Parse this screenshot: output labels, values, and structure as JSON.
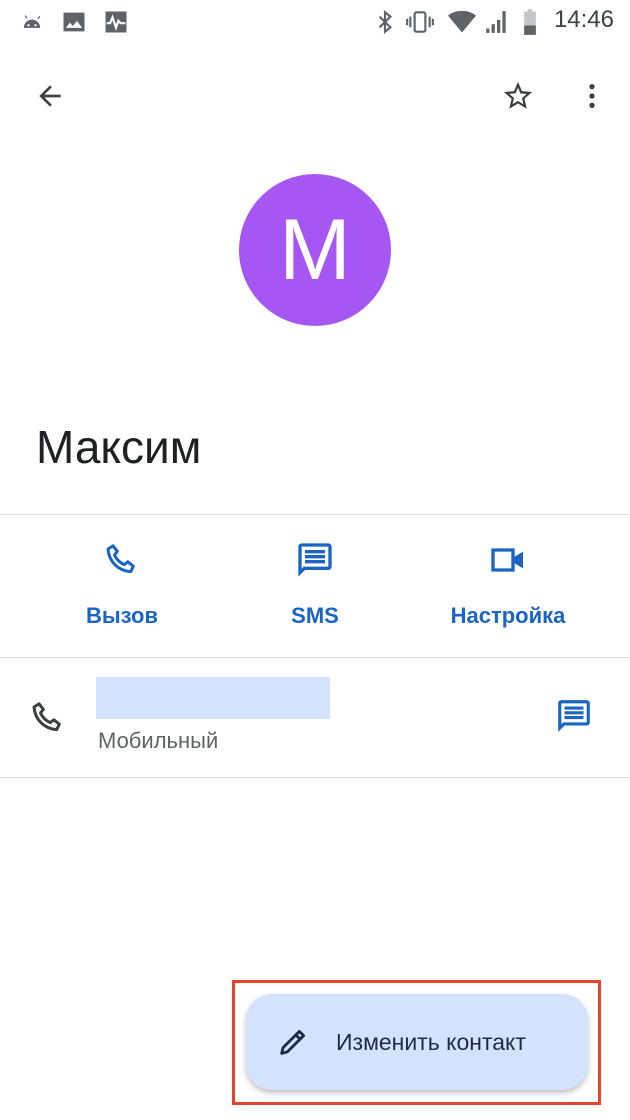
{
  "status_bar": {
    "time": "14:46",
    "left_icons": [
      "android-icon",
      "image-icon",
      "activity-icon"
    ],
    "right_icons": [
      "bluetooth-icon",
      "vibrate-icon",
      "wifi-icon",
      "cell-signal-icon",
      "battery-icon"
    ]
  },
  "toolbar": {
    "back_icon": "arrow-left-icon",
    "star_icon": "star-outline-icon",
    "more_icon": "more-vert-icon"
  },
  "contact": {
    "avatar_letter": "M",
    "avatar_color": "#a656f2",
    "name": "Максим"
  },
  "actions": [
    {
      "label": "Вызов",
      "icon": "phone-icon"
    },
    {
      "label": "SMS",
      "icon": "message-icon"
    },
    {
      "label": "Настройка",
      "icon": "video-icon"
    }
  ],
  "phone_entry": {
    "type_label": "Мобильный",
    "icon": "phone-icon",
    "message_icon": "message-icon"
  },
  "fab": {
    "label": "Изменить контакт",
    "icon": "edit-pencil-icon",
    "background": "#d3e3fd"
  },
  "colors": {
    "accent": "#1a64c4",
    "highlight": "#e5452a"
  }
}
